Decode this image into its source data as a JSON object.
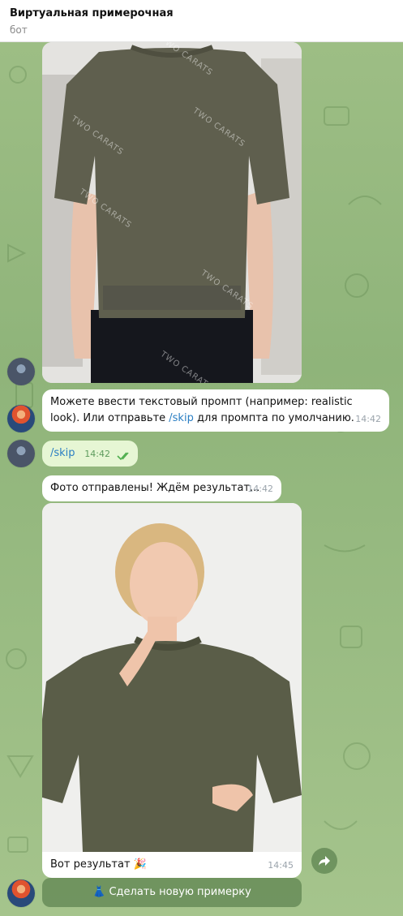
{
  "header": {
    "title": "Виртуальная примерочная",
    "subtitle": "бот"
  },
  "photo1": {
    "watermark": "TWO CARATS"
  },
  "messages": {
    "prompt": {
      "text_before": "Можете ввести текстовый промпт (например: realistic look). Или отправьте ",
      "cmd": "/skip",
      "text_after": " для промпта по умолчанию.",
      "time": "14:42"
    },
    "skip": {
      "text": "/skip",
      "time": "14:42"
    },
    "sent": {
      "text": "Фото отправлены! Ждём результат...",
      "time": "14:42"
    },
    "result": {
      "text": "Вот результат 🎉",
      "time": "14:45"
    }
  },
  "button": {
    "label": "👗 Сделать новую примерку"
  },
  "colors": {
    "accent": "#2a7ec3",
    "outgoing_bubble": "#e6f6d4",
    "check": "#4fae4e"
  },
  "icons": [
    "share-icon",
    "double-check-icon",
    "dress-icon"
  ]
}
